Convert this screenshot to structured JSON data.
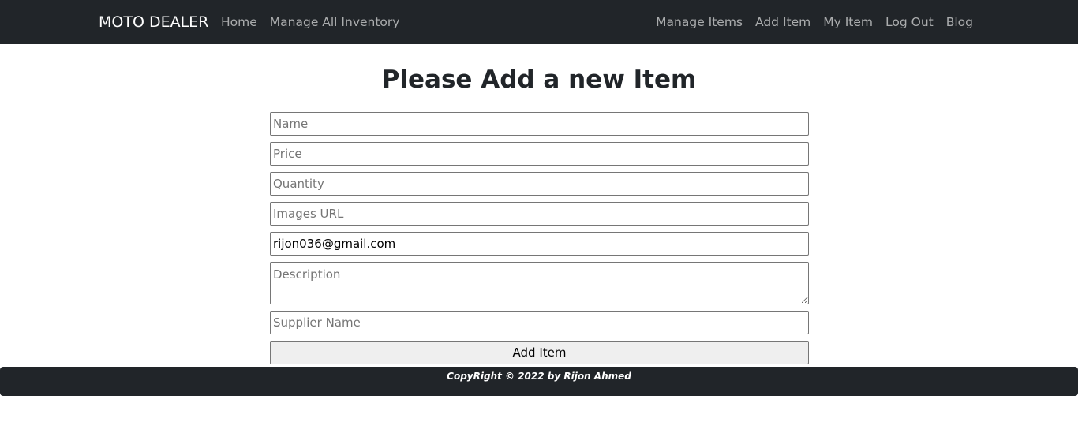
{
  "navbar": {
    "brand": "MOTO DEALER",
    "left_links": [
      {
        "label": "Home"
      },
      {
        "label": "Manage All Inventory"
      }
    ],
    "right_links": [
      {
        "label": "Manage Items"
      },
      {
        "label": "Add Item"
      },
      {
        "label": "My Item"
      },
      {
        "label": "Log Out"
      },
      {
        "label": "Blog"
      }
    ]
  },
  "main": {
    "title": "Please Add a new Item",
    "form": {
      "name": {
        "placeholder": "Name",
        "value": ""
      },
      "price": {
        "placeholder": "Price",
        "value": ""
      },
      "quantity": {
        "placeholder": "Quantity",
        "value": ""
      },
      "images_url": {
        "placeholder": "Images URL",
        "value": ""
      },
      "email": {
        "placeholder": "",
        "value": "rijon036@gmail.com"
      },
      "description": {
        "placeholder": "Description",
        "value": ""
      },
      "supplier": {
        "placeholder": "Supplier Name",
        "value": ""
      },
      "submit_label": "Add Item"
    }
  },
  "footer": {
    "text": "CopyRight © 2022 by Rijon Ahmed"
  },
  "colors": {
    "navbar_bg": "#212529",
    "nav_link": "rgba(255,255,255,0.62)",
    "button_bg": "#efefef"
  }
}
